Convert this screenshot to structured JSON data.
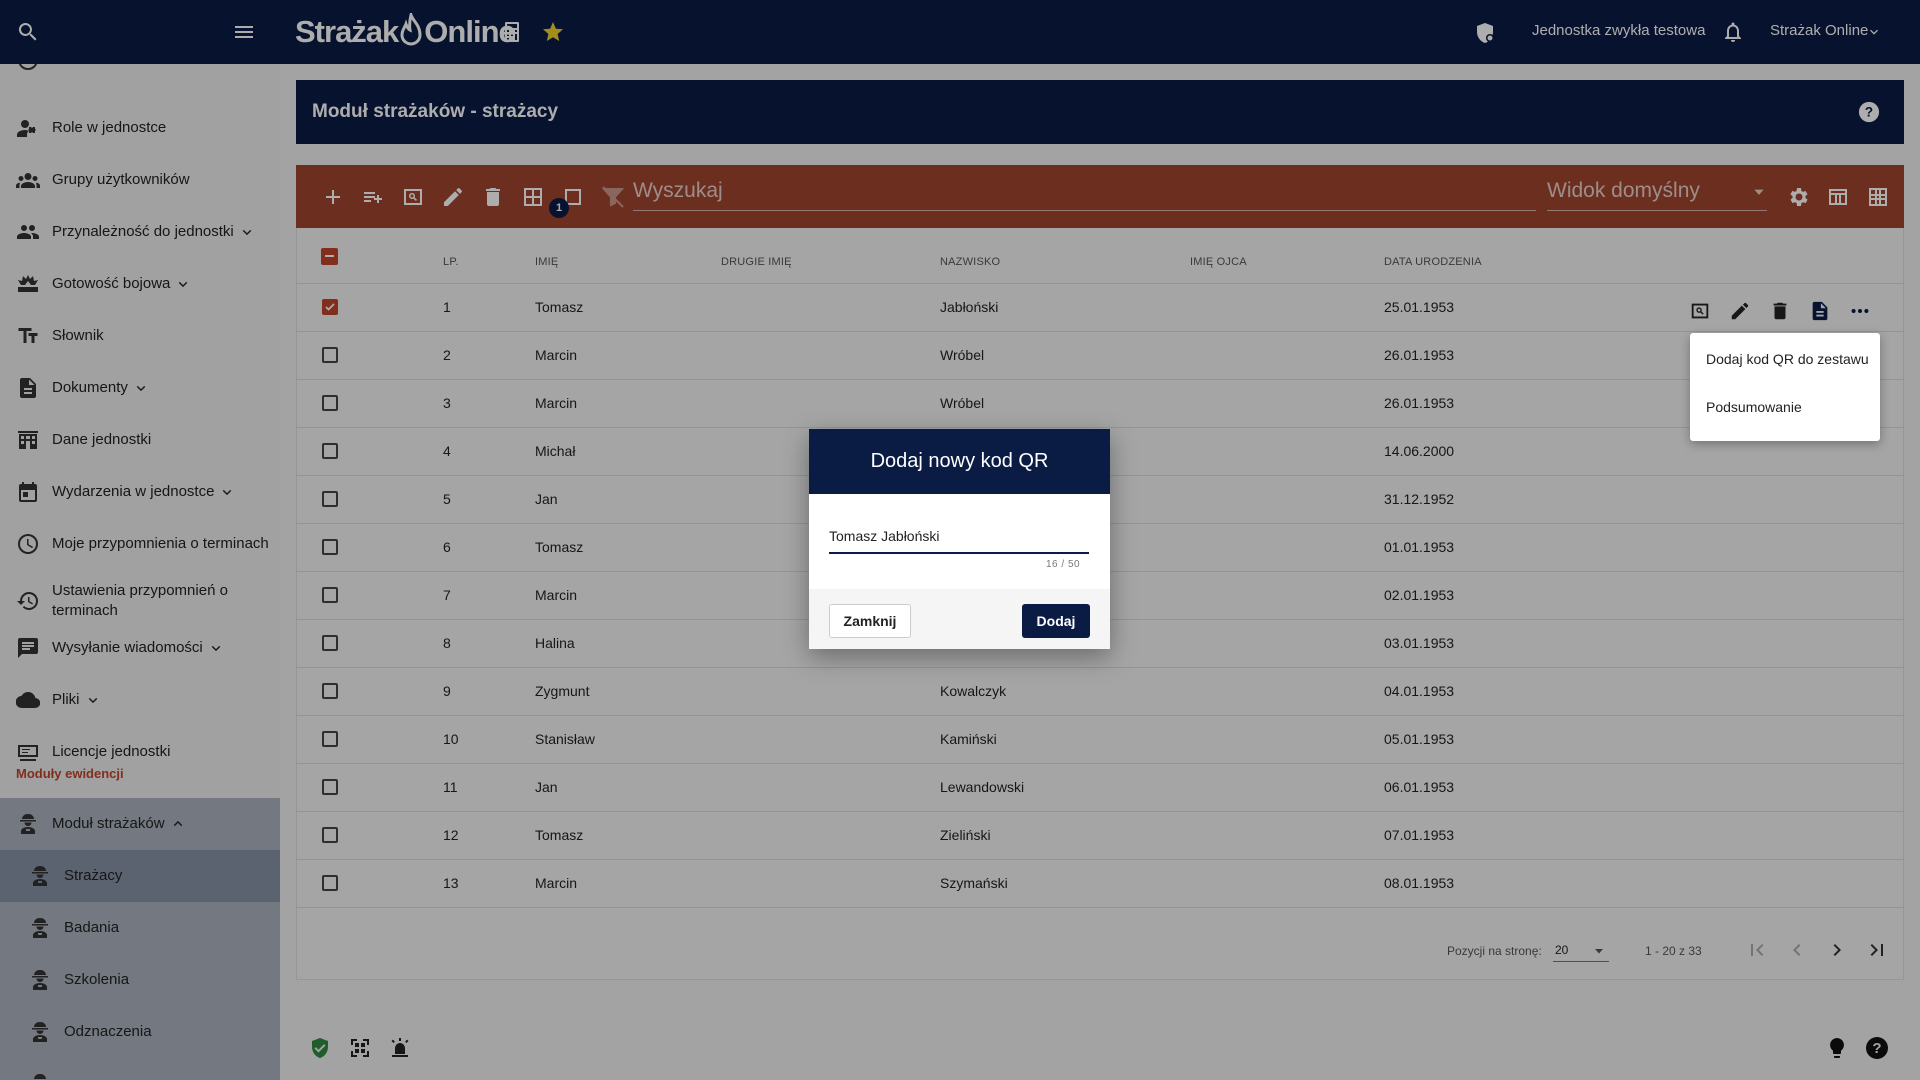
{
  "topbar": {
    "logo_text_left": "Strażak",
    "logo_text_right": "Online",
    "unit_name": "Jednostka zwykła testowa",
    "account_name": "Strażak Online"
  },
  "sidebar": {
    "items": [
      {
        "label": "Role w jednostce",
        "icon": "person-roles-icon",
        "chevron": ""
      },
      {
        "label": "Grupy użytkowników",
        "icon": "groups-icon",
        "chevron": ""
      },
      {
        "label": "Przynależność do jednostki",
        "icon": "people-icon",
        "chevron": "down"
      },
      {
        "label": "Gotowość bojowa",
        "icon": "readiness-icon",
        "chevron": "down"
      },
      {
        "label": "Słownik",
        "icon": "text-fields-icon",
        "chevron": ""
      },
      {
        "label": "Dokumenty",
        "icon": "document-icon",
        "chevron": "down"
      },
      {
        "label": "Dane jednostki",
        "icon": "building-icon",
        "chevron": ""
      },
      {
        "label": "Wydarzenia w jednostce",
        "icon": "calendar-icon",
        "chevron": "down"
      },
      {
        "label": "Moje przypomnienia o terminach",
        "icon": "clock-icon",
        "chevron": ""
      },
      {
        "label": "Ustawienia przypomnień o terminach",
        "icon": "timer-settings-icon",
        "chevron": ""
      },
      {
        "label": "Wysyłanie wiadomości",
        "icon": "message-icon",
        "chevron": "down"
      },
      {
        "label": "Pliki",
        "icon": "cloud-icon",
        "chevron": "down"
      },
      {
        "label": "Licencje jednostki",
        "icon": "license-icon",
        "chevron": ""
      }
    ],
    "section_title": "Moduły ewidencji",
    "module": {
      "label": "Moduł strażaków",
      "chevron": "up"
    },
    "sub_items": [
      {
        "label": "Strażacy",
        "active": true
      },
      {
        "label": "Badania",
        "active": false
      },
      {
        "label": "Szkolenia",
        "active": false
      },
      {
        "label": "Odznaczenia",
        "active": false
      }
    ]
  },
  "header": {
    "title": "Moduł strażaków - strażacy"
  },
  "toolbar": {
    "search_placeholder": "Wyszukaj",
    "view_label": "Widok domyślny",
    "selected_count": "1"
  },
  "table": {
    "columns": [
      "LP.",
      "IMIĘ",
      "DRUGIE IMIĘ",
      "NAZWISKO",
      "IMIĘ OJCA",
      "DATA URODZENIA"
    ],
    "rows": [
      {
        "lp": "1",
        "imie": "Tomasz",
        "nazwisko": "Jabłoński",
        "data": "25.01.1953",
        "checked": true
      },
      {
        "lp": "2",
        "imie": "Marcin",
        "nazwisko": "Wróbel",
        "data": "26.01.1953",
        "checked": false
      },
      {
        "lp": "3",
        "imie": "Marcin",
        "nazwisko": "Wróbel",
        "data": "26.01.1953",
        "checked": false
      },
      {
        "lp": "4",
        "imie": "Michał",
        "nazwisko": "",
        "data": "14.06.2000",
        "checked": false
      },
      {
        "lp": "5",
        "imie": "Jan",
        "nazwisko": "",
        "data": "31.12.1952",
        "checked": false
      },
      {
        "lp": "6",
        "imie": "Tomasz",
        "nazwisko": "",
        "data": "01.01.1953",
        "checked": false
      },
      {
        "lp": "7",
        "imie": "Marcin",
        "nazwisko": "",
        "data": "02.01.1953",
        "checked": false
      },
      {
        "lp": "8",
        "imie": "Halina",
        "nazwisko": "",
        "data": "03.01.1953",
        "checked": false
      },
      {
        "lp": "9",
        "imie": "Zygmunt",
        "nazwisko": "Kowalczyk",
        "data": "04.01.1953",
        "checked": false
      },
      {
        "lp": "10",
        "imie": "Stanisław",
        "nazwisko": "Kamiński",
        "data": "05.01.1953",
        "checked": false
      },
      {
        "lp": "11",
        "imie": "Jan",
        "nazwisko": "Lewandowski",
        "data": "06.01.1953",
        "checked": false
      },
      {
        "lp": "12",
        "imie": "Tomasz",
        "nazwisko": "Zieliński",
        "data": "07.01.1953",
        "checked": false
      },
      {
        "lp": "13",
        "imie": "Marcin",
        "nazwisko": "Szymański",
        "data": "08.01.1953",
        "checked": false
      }
    ]
  },
  "pagination": {
    "per_page_label": "Pozycji na stronę:",
    "per_page_value": "20",
    "range": "1 - 20 z 33"
  },
  "context_menu": {
    "items": [
      "Dodaj kod QR do zestawu",
      "Podsumowanie"
    ]
  },
  "dialog": {
    "title": "Dodaj nowy kod QR",
    "input_value": "Tomasz Jabłoński",
    "char_counter": "16 / 50",
    "close_label": "Zamknij",
    "add_label": "Dodaj"
  },
  "colors": {
    "navy": "#0a1b44",
    "toolbar": "#a0452d",
    "section_title": "#c0442b",
    "checkbox_accent": "#c0442b",
    "star": "#f2d02f"
  }
}
